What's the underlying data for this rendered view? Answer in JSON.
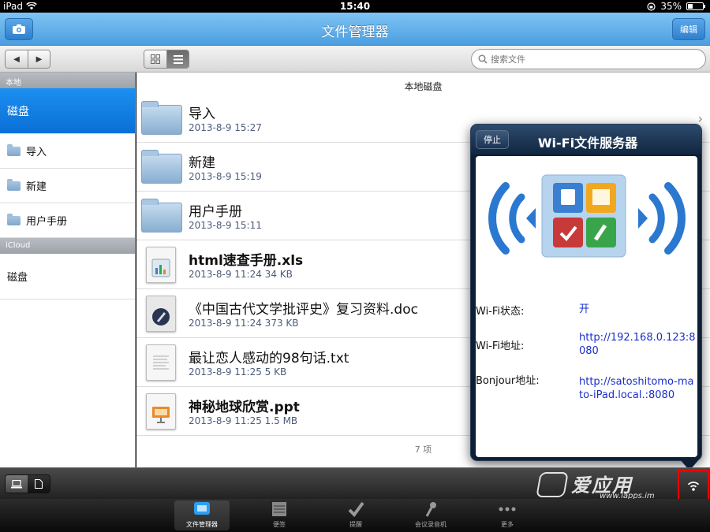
{
  "status": {
    "device": "iPad",
    "time": "15:40",
    "battery": "35%",
    "battery_level": 0.35
  },
  "nav": {
    "title": "文件管理器",
    "edit_label": "编辑",
    "camera_icon": "camera-icon"
  },
  "toolbar": {
    "back_icon": "◀",
    "forward_icon": "▶",
    "search_placeholder": "搜索文件"
  },
  "sidebar": {
    "local_header": "本地",
    "selected": "磁盘",
    "items": [
      "导入",
      "新建",
      "用户手册"
    ],
    "icloud_header": "iCloud",
    "icloud_item": "磁盘"
  },
  "main": {
    "header": "本地磁盘",
    "files": [
      {
        "name": "导入",
        "meta": "2013-8-9 15:27",
        "type": "folder"
      },
      {
        "name": "新建",
        "meta": "2013-8-9 15:19",
        "type": "folder"
      },
      {
        "name": "用户手册",
        "meta": "2013-8-9 15:11",
        "type": "folder"
      },
      {
        "name": "html速查手册.xls",
        "meta": "2013-8-9 11:24   34 KB",
        "type": "xls"
      },
      {
        "name": "《中国古代文学批评史》复习资料.doc",
        "meta": "2013-8-9 11:24   373 KB",
        "type": "doc"
      },
      {
        "name": "最让恋人感动的98句话.txt",
        "meta": "2013-8-9 11:25   5 KB",
        "type": "txt"
      },
      {
        "name": "神秘地球欣赏.ppt",
        "meta": "2013-8-9 11:25   1.5 MB",
        "type": "ppt"
      }
    ],
    "count": "7 项"
  },
  "popover": {
    "title": "Wi-Fi文件服务器",
    "stop_label": "停止",
    "status_label": "Wi-Fi状态:",
    "status_value": "开",
    "address_label": "Wi-Fi地址:",
    "address_value": "http://192.168.0.123:8080",
    "bonjour_label": "Bonjour地址:",
    "bonjour_value": "http://satoshitomo-mato-iPad.local.:8080"
  },
  "watermark": {
    "brand": "爱应用",
    "url": "www.iapps.im"
  },
  "tabs": [
    "文件管理器",
    "便签",
    "提醒",
    "会议录音机",
    "更多"
  ]
}
